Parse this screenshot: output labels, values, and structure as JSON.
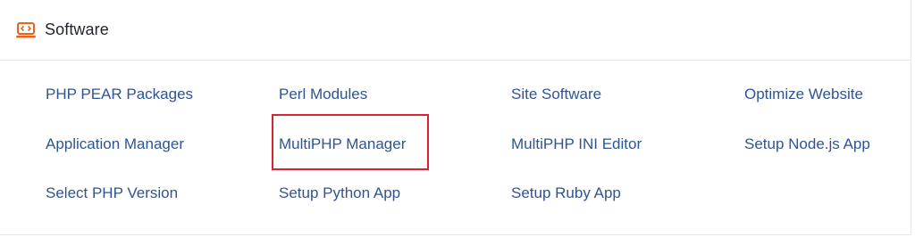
{
  "section": {
    "title": "Software",
    "icon": "software-monitor-icon",
    "accent_color": "#e8641c"
  },
  "items": [
    {
      "label": "PHP PEAR Packages"
    },
    {
      "label": "Perl Modules"
    },
    {
      "label": "Site Software"
    },
    {
      "label": "Optimize Website"
    },
    {
      "label": "Application Manager"
    },
    {
      "label": "MultiPHP Manager"
    },
    {
      "label": "MultiPHP INI Editor"
    },
    {
      "label": "Setup Node.js App"
    },
    {
      "label": "Select PHP Version"
    },
    {
      "label": "Setup Python App"
    },
    {
      "label": "Setup Ruby App"
    }
  ],
  "highlight": {
    "target": "MultiPHP Manager",
    "color": "#d9232e"
  },
  "colors": {
    "link": "#2f5490",
    "title": "#1f2430",
    "divider": "#e4e6ea"
  }
}
